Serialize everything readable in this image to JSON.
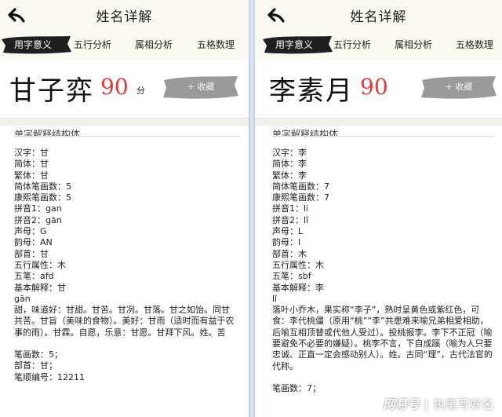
{
  "left": {
    "title": "姓名详解",
    "tabs": [
      "用字意义",
      "五行分析",
      "属相分析",
      "五格数理"
    ],
    "name": "甘子弈",
    "score": "90",
    "score_unit": "分",
    "favorite_label": "+ 收藏",
    "section_title": "单字解释结构体",
    "lines": [
      "汉字：甘",
      "简体：甘",
      "繁体：甘",
      "简体笔画数：5",
      "康熙笔画数：5",
      "拼音1：gan",
      "拼音2：gān",
      "声母：G",
      "韵母：AN",
      "部首：甘",
      "五行属性：木",
      "五笔：afd",
      "基本解释：甘",
      "gān"
    ],
    "meaning": "甜，味道好：甘甜。甘苦。甘冽。甘落。甘之如饴。同甘共苦。甘旨（美味的食物）。美好：甘雨（适时而有益于农事的雨）。甘霖。自愿，乐意：甘愿。甘拜下风。姓。苦",
    "strokes": [
      "笔画数：5；",
      "部首：甘；",
      "笔顺编号：12211"
    ]
  },
  "right": {
    "title": "姓名详解",
    "tabs": [
      "用字意义",
      "五行分析",
      "属相分析",
      "五格数理"
    ],
    "name": "李素月",
    "score": "90",
    "score_unit": "分",
    "favorite_label": "+ 收藏",
    "section_title": "单字解释结构体",
    "lines": [
      "汉字：李",
      "简体：李",
      "繁体：李",
      "简体笔画数：7",
      "康熙笔画数：7",
      "拼音1：li",
      "拼音2：lǐ",
      "声母：L",
      "韵母：I",
      "部首：木",
      "五行属性：木",
      "五笔：sbf",
      "基本解释：李",
      "lǐ"
    ],
    "meaning": "落叶小乔木，果实称“李子”，熟时呈黄色或紫红色，可食：李代桃僵（原用“桃”“李”共患难来喻兄弟相爱相助，后喻互相顶替或代他人受过）。投桃报李。李下不正冠（喻要避免不必要的嫌疑）。桃李不言，下自成蹊（喻为人只要忠诚、正直一定会感动别人）。姓。古同“理”，古代法官的代称。",
    "strokes": [
      "笔画数：7；"
    ]
  },
  "watermark": {
    "logo": "网易号",
    "separator": "|",
    "author": "执笔写好名"
  },
  "colors": {
    "score": "#e03a3a",
    "header_bg": "#fafaf3",
    "brush_dark": "#1f1f1f",
    "brush_gray": "#9a9a9a"
  }
}
